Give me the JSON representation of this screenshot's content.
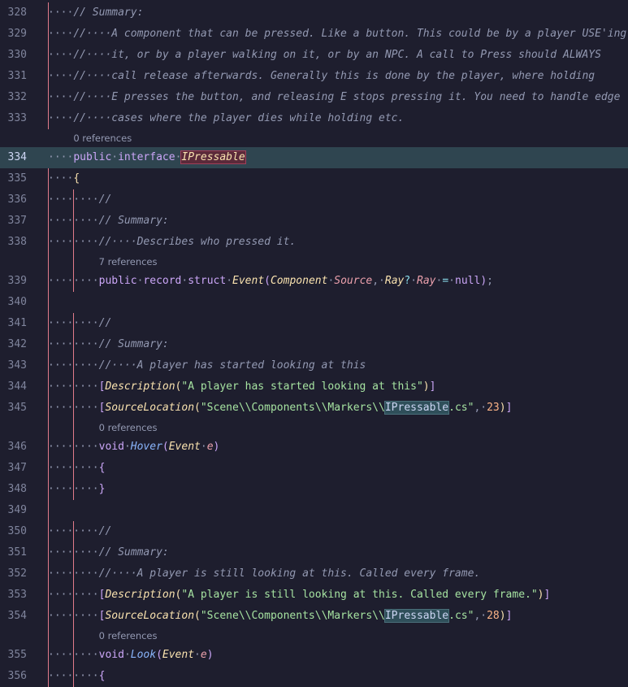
{
  "lines": [
    {
      "n": "328",
      "ind": "····",
      "tokens": [
        [
          "c",
          "// Summary:"
        ]
      ]
    },
    {
      "n": "329",
      "ind": "····",
      "tokens": [
        [
          "c",
          "//····A component that can be pressed. Like a button. This could be by a player USE'ing"
        ]
      ]
    },
    {
      "n": "330",
      "ind": "····",
      "tokens": [
        [
          "c",
          "//····it, or by a player walking on it, or by an NPC. A call to Press should ALWAYS"
        ]
      ]
    },
    {
      "n": "331",
      "ind": "····",
      "tokens": [
        [
          "c",
          "//····call release afterwards. Generally this is done by the player, where holding"
        ]
      ]
    },
    {
      "n": "332",
      "ind": "····",
      "tokens": [
        [
          "c",
          "//····E presses the button, and releasing E stops pressing it. You need to handle edge"
        ]
      ]
    },
    {
      "n": "333",
      "ind": "····",
      "tokens": [
        [
          "c",
          "//····cases where the player dies while holding etc."
        ]
      ]
    },
    {
      "lens": "0 references",
      "indent": 4
    },
    {
      "n": "334",
      "ind": "····",
      "hl": true,
      "tokens": [
        [
          "kw",
          "public"
        ],
        [
          "pun",
          "·"
        ],
        [
          "kw",
          "interface"
        ],
        [
          "pun",
          "·"
        ],
        [
          "iface",
          "IPressable"
        ]
      ]
    },
    {
      "n": "335",
      "ind": "····",
      "tokens": [
        [
          "br",
          "{"
        ]
      ]
    },
    {
      "n": "336",
      "ind": "········",
      "tokens": [
        [
          "c",
          "//"
        ]
      ]
    },
    {
      "n": "337",
      "ind": "········",
      "tokens": [
        [
          "c",
          "// Summary:"
        ]
      ]
    },
    {
      "n": "338",
      "ind": "········",
      "tokens": [
        [
          "c",
          "//····Describes who pressed it."
        ]
      ]
    },
    {
      "lens": "7 references",
      "indent": 8
    },
    {
      "n": "339",
      "ind": "········",
      "tokens": [
        [
          "kw",
          "public"
        ],
        [
          "pun",
          "·"
        ],
        [
          "kw",
          "record"
        ],
        [
          "pun",
          "·"
        ],
        [
          "kw",
          "struct"
        ],
        [
          "pun",
          "·"
        ],
        [
          "ty",
          "Event"
        ],
        [
          "br2",
          "("
        ],
        [
          "ty",
          "Component"
        ],
        [
          "pun",
          "·"
        ],
        [
          "pa",
          "Source"
        ],
        [
          "pun",
          ",·"
        ],
        [
          "ty",
          "Ray"
        ],
        [
          "op",
          "?"
        ],
        [
          "pun",
          "·"
        ],
        [
          "pa",
          "Ray"
        ],
        [
          "pun",
          "·"
        ],
        [
          "op",
          "="
        ],
        [
          "pun",
          "·"
        ],
        [
          "kw",
          "null"
        ],
        [
          "br2",
          ")"
        ],
        [
          "pun",
          ";"
        ]
      ]
    },
    {
      "n": "340",
      "ind": "",
      "tokens": []
    },
    {
      "n": "341",
      "ind": "········",
      "tokens": [
        [
          "c",
          "//"
        ]
      ]
    },
    {
      "n": "342",
      "ind": "········",
      "tokens": [
        [
          "c",
          "// Summary:"
        ]
      ]
    },
    {
      "n": "343",
      "ind": "········",
      "tokens": [
        [
          "c",
          "//····A player has started looking at this"
        ]
      ]
    },
    {
      "n": "344",
      "ind": "········",
      "tokens": [
        [
          "br2",
          "["
        ],
        [
          "attr",
          "Description"
        ],
        [
          "br",
          "("
        ],
        [
          "str",
          "\"A player has started looking at this\""
        ],
        [
          "br",
          ")"
        ],
        [
          "br2",
          "]"
        ]
      ]
    },
    {
      "n": "345",
      "ind": "········",
      "tokens": [
        [
          "br2",
          "["
        ],
        [
          "attr",
          "SourceLocation"
        ],
        [
          "br",
          "("
        ],
        [
          "str",
          "\"Scene\\\\Components\\\\Markers\\\\"
        ],
        [
          "mark",
          "IPressable"
        ],
        [
          "str",
          ".cs\""
        ],
        [
          "pun",
          ",·"
        ],
        [
          "num",
          "23"
        ],
        [
          "br",
          ")"
        ],
        [
          "br2",
          "]"
        ]
      ]
    },
    {
      "lens": "0 references",
      "indent": 8
    },
    {
      "n": "346",
      "ind": "········",
      "tokens": [
        [
          "kw",
          "void"
        ],
        [
          "pun",
          "·"
        ],
        [
          "fn",
          "Hover"
        ],
        [
          "br2",
          "("
        ],
        [
          "ty",
          "Event"
        ],
        [
          "pun",
          "·"
        ],
        [
          "pa",
          "e"
        ],
        [
          "br2",
          ")"
        ]
      ]
    },
    {
      "n": "347",
      "ind": "········",
      "tokens": [
        [
          "br2",
          "{"
        ]
      ]
    },
    {
      "n": "348",
      "ind": "········",
      "tokens": [
        [
          "br2",
          "}"
        ]
      ]
    },
    {
      "n": "349",
      "ind": "",
      "tokens": []
    },
    {
      "n": "350",
      "ind": "········",
      "tokens": [
        [
          "c",
          "//"
        ]
      ]
    },
    {
      "n": "351",
      "ind": "········",
      "tokens": [
        [
          "c",
          "// Summary:"
        ]
      ]
    },
    {
      "n": "352",
      "ind": "········",
      "tokens": [
        [
          "c",
          "//····A player is still looking at this. Called every frame."
        ]
      ]
    },
    {
      "n": "353",
      "ind": "········",
      "tokens": [
        [
          "br2",
          "["
        ],
        [
          "attr",
          "Description"
        ],
        [
          "br",
          "("
        ],
        [
          "str",
          "\"A player is still looking at this. Called every frame.\""
        ],
        [
          "br",
          ")"
        ],
        [
          "br2",
          "]"
        ]
      ]
    },
    {
      "n": "354",
      "ind": "········",
      "tokens": [
        [
          "br2",
          "["
        ],
        [
          "attr",
          "SourceLocation"
        ],
        [
          "br",
          "("
        ],
        [
          "str",
          "\"Scene\\\\Components\\\\Markers\\\\"
        ],
        [
          "mark",
          "IPressable"
        ],
        [
          "str",
          ".cs\""
        ],
        [
          "pun",
          ",·"
        ],
        [
          "num",
          "28"
        ],
        [
          "br",
          ")"
        ],
        [
          "br2",
          "]"
        ]
      ]
    },
    {
      "lens": "0 references",
      "indent": 8
    },
    {
      "n": "355",
      "ind": "········",
      "tokens": [
        [
          "kw",
          "void"
        ],
        [
          "pun",
          "·"
        ],
        [
          "fn",
          "Look"
        ],
        [
          "br2",
          "("
        ],
        [
          "ty",
          "Event"
        ],
        [
          "pun",
          "·"
        ],
        [
          "pa",
          "e"
        ],
        [
          "br2",
          ")"
        ]
      ]
    },
    {
      "n": "356",
      "ind": "········",
      "tokens": [
        [
          "br2",
          "{"
        ]
      ]
    }
  ]
}
